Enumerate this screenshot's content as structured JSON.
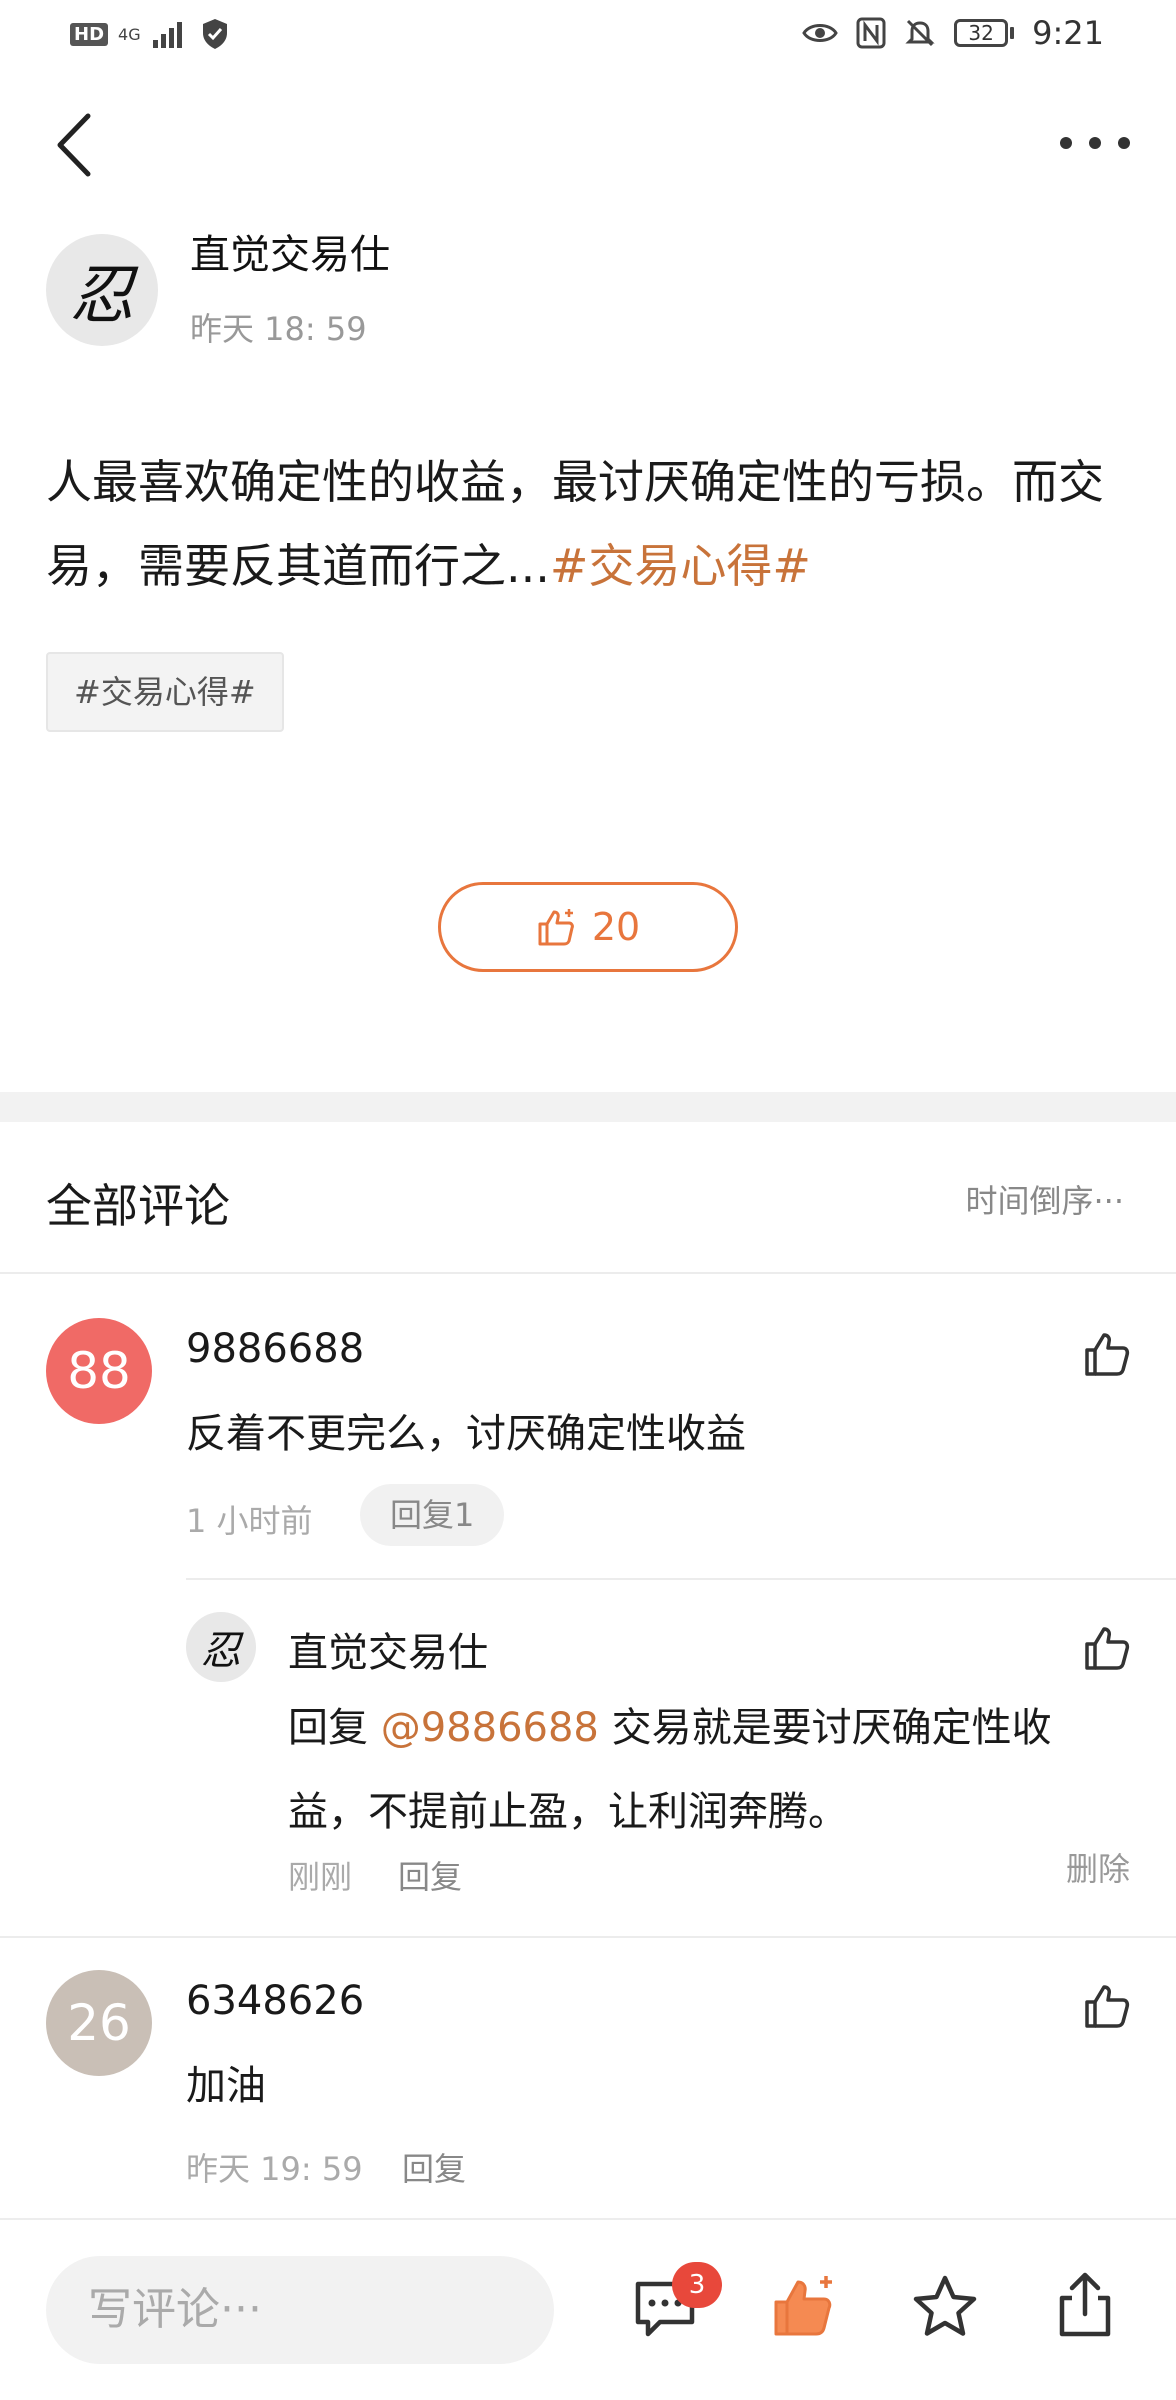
{
  "status_bar": {
    "hd": "HD",
    "network": "4G",
    "battery": "32",
    "time": "9:21"
  },
  "post": {
    "author": "直觉交易仕",
    "avatar_glyph": "忍",
    "time": "昨天 18: 59",
    "body_text": "人最喜欢确定性的收益，最讨厌确定性的亏损。而交易，需要反其道而行之...",
    "body_hashtag": "#交易心得#",
    "topic_tag": "#交易心得#",
    "like_count": "20"
  },
  "comments_section": {
    "title": "全部评论",
    "sort_label": "时间倒序",
    "sort_more": "···"
  },
  "comments": [
    {
      "avatar_text": "88",
      "avatar_color": "#f06a66",
      "user": "9886688",
      "text": "反着不更完么，讨厌确定性收益",
      "time": "1 小时前",
      "reply_label": "回复1"
    },
    {
      "avatar_text": "26",
      "avatar_color": "#c9bfb6",
      "user": "6348626",
      "text": "加油",
      "time": "昨天 19: 59",
      "reply_label": "回复"
    }
  ],
  "reply": {
    "user": "直觉交易仕",
    "avatar_glyph": "忍",
    "prefix": "回复",
    "mention": "@9886688",
    "text_line1": "交易就是要讨厌确定性收",
    "text_line2": "益，不提前止盈，让利润奔腾。",
    "time": "刚刚",
    "reply_label": "回复",
    "delete_label": "删除"
  },
  "bottom_bar": {
    "input_placeholder": "写评论···",
    "comment_badge": "3"
  },
  "colors": {
    "accent": "#e8763d",
    "hashtag": "#c8733a",
    "badge": "#e8483b"
  }
}
